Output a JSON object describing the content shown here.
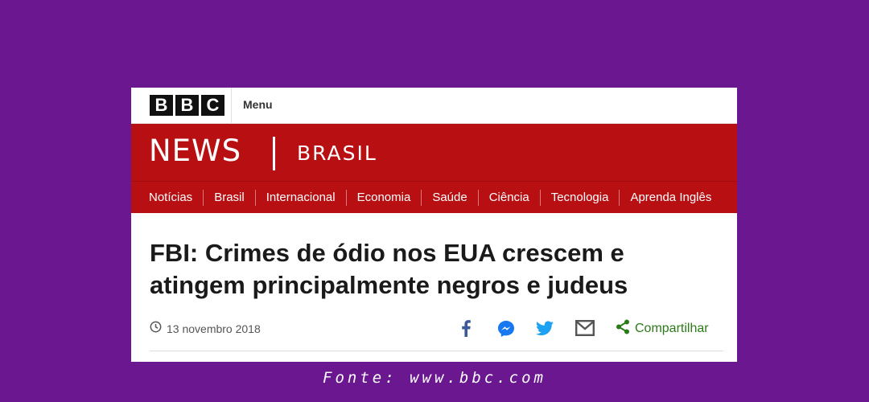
{
  "topbar": {
    "logo_letters": [
      "B",
      "B",
      "C"
    ],
    "menu_label": "Menu"
  },
  "masthead": {
    "news_label": "NEWS",
    "edition_label": "BRASIL",
    "background_color": "#b80f12"
  },
  "nav": {
    "items": [
      {
        "label": "Notícias"
      },
      {
        "label": "Brasil"
      },
      {
        "label": "Internacional"
      },
      {
        "label": "Economia"
      },
      {
        "label": "Saúde"
      },
      {
        "label": "Ciência"
      },
      {
        "label": "Tecnologia"
      },
      {
        "label": "Aprenda Inglês"
      }
    ]
  },
  "article": {
    "headline": "FBI: Crimes de ódio nos EUA crescem e atingem principalmente negros e judeus",
    "date": "13 novembro 2018",
    "date_icon": "clock-icon"
  },
  "share": {
    "icons": [
      "facebook-icon",
      "messenger-icon",
      "twitter-icon",
      "email-icon"
    ],
    "label": "Compartilhar",
    "share_icon": "share-icon",
    "accent_color": "#2b7a18"
  },
  "footer": {
    "source": "Fonte: www.bbc.com"
  },
  "page": {
    "background_color": "#6a1790"
  }
}
